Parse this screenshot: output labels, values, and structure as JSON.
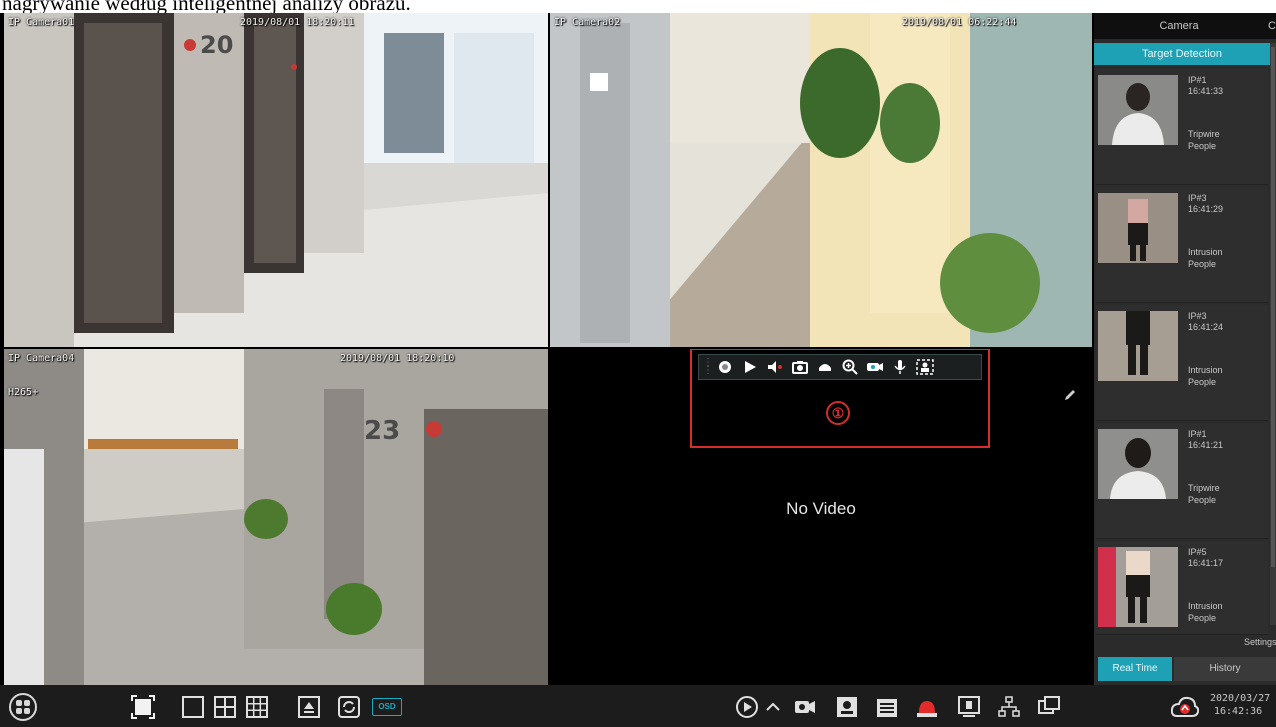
{
  "page_caption": "nagrywanie według inteligentnej analizy obrazu.",
  "cameras": [
    {
      "name": "IP Camera01",
      "time": "2019/08/01 18:20:11"
    },
    {
      "name": "IP Camera02",
      "time": "2019/08/01 06:22:44"
    },
    {
      "name": "IP Camera04",
      "time": "2019/08/01 18:20:10",
      "codec": "H265+"
    },
    {
      "status": "No Video"
    }
  ],
  "float_toolbar": {
    "buttons": [
      "record-icon",
      "playback-icon",
      "audio-icon",
      "snapshot-icon",
      "ptz-icon",
      "zoom-icon",
      "camera-color-icon",
      "microphone-icon",
      "smart-detect-icon"
    ],
    "marker": "①"
  },
  "side_panel": {
    "tab_camera": "Camera",
    "tab_more": "C",
    "mode": "Target Detection",
    "events": [
      {
        "camera": "IP#1",
        "time": "16:41:33",
        "type": "Tripwire",
        "object": "People"
      },
      {
        "camera": "IP#3",
        "time": "16:41:29",
        "type": "Intrusion",
        "object": "People"
      },
      {
        "camera": "IP#3",
        "time": "16:41:24",
        "type": "Intrusion",
        "object": "People"
      },
      {
        "camera": "IP#1",
        "time": "16:41:21",
        "type": "Tripwire",
        "object": "People"
      },
      {
        "camera": "IP#5",
        "time": "16:41:17",
        "type": "Intrusion",
        "object": "People"
      }
    ],
    "settings": "Settings",
    "bottom_tabs": {
      "realtime": "Real Time",
      "history": "History"
    }
  },
  "taskbar": {
    "left_buttons": [
      "start-menu-icon",
      "fullscreen-icon",
      "layout-1-icon",
      "layout-4-icon",
      "layout-9-icon",
      "screen-select-icon",
      "sequence-icon"
    ],
    "osd_label": "OSD",
    "right_buttons": [
      "playback-icon",
      "collapse-icon",
      "manual-record-icon",
      "alarm-status-icon",
      "record-status-icon",
      "alarm-icon",
      "disk-info-icon",
      "network-icon",
      "info-icon"
    ],
    "date": "2020/03/27",
    "time": "16:42:36"
  },
  "colors": {
    "accent": "#1fa1b5",
    "highlight": "#d62c2c"
  }
}
